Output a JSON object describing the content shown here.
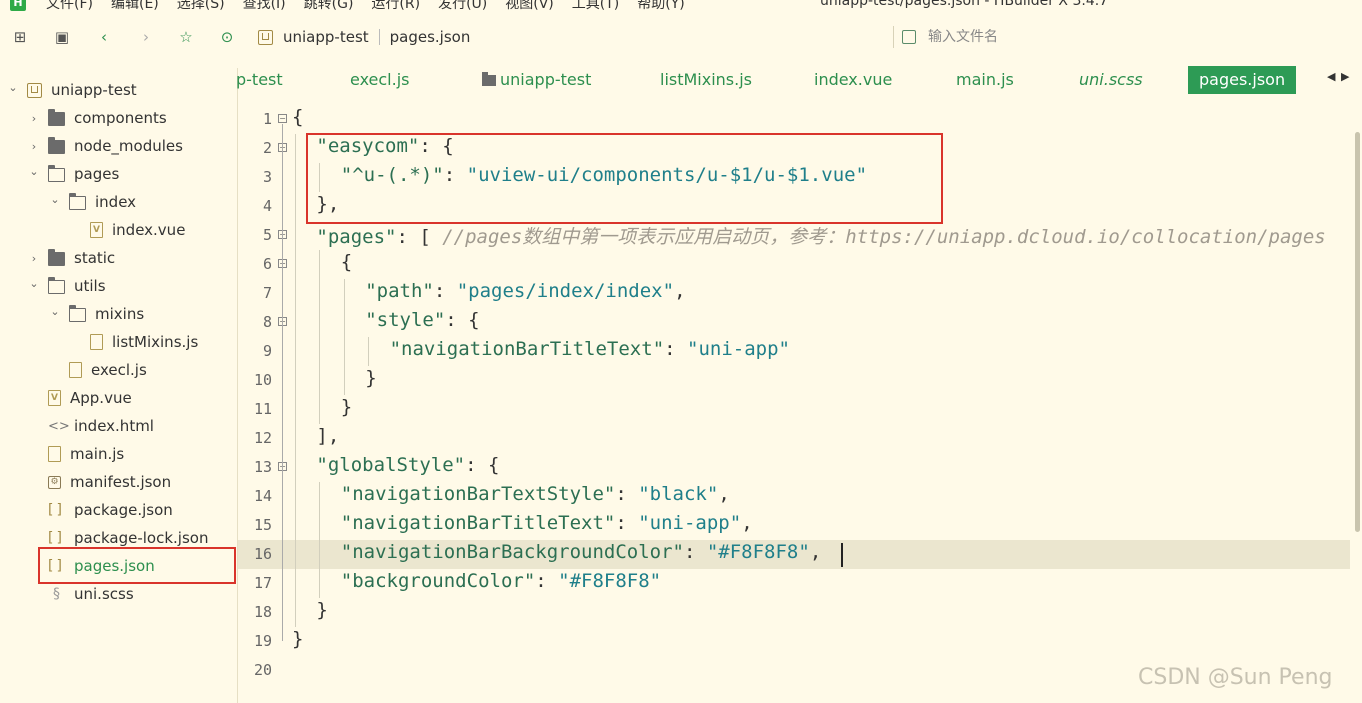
{
  "window": {
    "title": "uniapp-test/pages.json - HBuilder X 3.4.7",
    "menu": [
      "文件(F)",
      "编辑(E)",
      "选择(S)",
      "查找(I)",
      "跳转(G)",
      "运行(R)",
      "发行(U)",
      "视图(V)",
      "工具(T)",
      "帮助(Y)"
    ]
  },
  "toolbar": {
    "breadcrumb_project": "uniapp-test",
    "breadcrumb_file": "pages.json",
    "search_placeholder": "输入文件名"
  },
  "sidebar": {
    "items": [
      {
        "label": "uniapp-test",
        "type": "project",
        "depth": 0,
        "expanded": true
      },
      {
        "label": "components",
        "type": "folder",
        "depth": 1,
        "expanded": false
      },
      {
        "label": "node_modules",
        "type": "folder",
        "depth": 1,
        "expanded": false
      },
      {
        "label": "pages",
        "type": "folder",
        "depth": 1,
        "expanded": true
      },
      {
        "label": "index",
        "type": "folder",
        "depth": 2,
        "expanded": true
      },
      {
        "label": "index.vue",
        "type": "vue",
        "depth": 3
      },
      {
        "label": "static",
        "type": "folder",
        "depth": 1,
        "expanded": false
      },
      {
        "label": "utils",
        "type": "folder",
        "depth": 1,
        "expanded": true
      },
      {
        "label": "mixins",
        "type": "folder",
        "depth": 2,
        "expanded": true
      },
      {
        "label": "listMixins.js",
        "type": "js",
        "depth": 3
      },
      {
        "label": "execl.js",
        "type": "js",
        "depth": 2
      },
      {
        "label": "App.vue",
        "type": "vue",
        "depth": 1
      },
      {
        "label": "index.html",
        "type": "html",
        "depth": 1
      },
      {
        "label": "main.js",
        "type": "js",
        "depth": 1
      },
      {
        "label": "manifest.json",
        "type": "manifest",
        "depth": 1
      },
      {
        "label": "package.json",
        "type": "json",
        "depth": 1
      },
      {
        "label": "package-lock.json",
        "type": "json",
        "depth": 1
      },
      {
        "label": "pages.json",
        "type": "json",
        "depth": 1,
        "active": true
      },
      {
        "label": "uni.scss",
        "type": "scss",
        "depth": 1
      }
    ]
  },
  "tabs": [
    {
      "label": "p-test"
    },
    {
      "label": "execl.js"
    },
    {
      "label": "uniapp-test",
      "folder": true
    },
    {
      "label": "listMixins.js"
    },
    {
      "label": "index.vue"
    },
    {
      "label": "main.js"
    },
    {
      "label": "uni.scss",
      "italic": true
    },
    {
      "label": "pages.json",
      "active": true
    }
  ],
  "editor": {
    "lines": [
      {
        "num": "1",
        "fold": true,
        "indent": 0,
        "parts": [
          [
            "p",
            "{"
          ]
        ]
      },
      {
        "num": "2",
        "fold": true,
        "indent": 1,
        "parts": [
          [
            "k",
            "\"easycom\""
          ],
          [
            "p",
            ": {"
          ]
        ]
      },
      {
        "num": "3",
        "indent": 2,
        "parts": [
          [
            "k",
            "\"^u-(.*)\""
          ],
          [
            "p",
            ": "
          ],
          [
            "s",
            "\"uview-ui/components/u-$1/u-$1.vue\""
          ]
        ]
      },
      {
        "num": "4",
        "indent": 1,
        "parts": [
          [
            "p",
            "},"
          ]
        ]
      },
      {
        "num": "5",
        "fold": true,
        "indent": 1,
        "parts": [
          [
            "k",
            "\"pages\""
          ],
          [
            "p",
            ": [ "
          ],
          [
            "c",
            "//pages数组中第一项表示应用启动页，参考：https://uniapp.dcloud.io/collocation/pages"
          ]
        ]
      },
      {
        "num": "6",
        "fold": true,
        "indent": 2,
        "parts": [
          [
            "p",
            "{"
          ]
        ]
      },
      {
        "num": "7",
        "indent": 3,
        "parts": [
          [
            "k",
            "\"path\""
          ],
          [
            "p",
            ": "
          ],
          [
            "s",
            "\"pages/index/index\""
          ],
          [
            "p",
            ","
          ]
        ]
      },
      {
        "num": "8",
        "fold": true,
        "indent": 3,
        "parts": [
          [
            "k",
            "\"style\""
          ],
          [
            "p",
            ": {"
          ]
        ]
      },
      {
        "num": "9",
        "indent": 4,
        "parts": [
          [
            "k",
            "\"navigationBarTitleText\""
          ],
          [
            "p",
            ": "
          ],
          [
            "s",
            "\"uni-app\""
          ]
        ]
      },
      {
        "num": "10",
        "indent": 3,
        "parts": [
          [
            "p",
            "}"
          ]
        ]
      },
      {
        "num": "11",
        "indent": 2,
        "parts": [
          [
            "p",
            "}"
          ]
        ]
      },
      {
        "num": "12",
        "indent": 1,
        "parts": [
          [
            "p",
            "],"
          ]
        ]
      },
      {
        "num": "13",
        "fold": true,
        "indent": 1,
        "parts": [
          [
            "k",
            "\"globalStyle\""
          ],
          [
            "p",
            ": {"
          ]
        ]
      },
      {
        "num": "14",
        "indent": 2,
        "parts": [
          [
            "k",
            "\"navigationBarTextStyle\""
          ],
          [
            "p",
            ": "
          ],
          [
            "s",
            "\"black\""
          ],
          [
            "p",
            ","
          ]
        ]
      },
      {
        "num": "15",
        "indent": 2,
        "parts": [
          [
            "k",
            "\"navigationBarTitleText\""
          ],
          [
            "p",
            ": "
          ],
          [
            "s",
            "\"uni-app\""
          ],
          [
            "p",
            ","
          ]
        ]
      },
      {
        "num": "16",
        "indent": 2,
        "current": true,
        "parts": [
          [
            "k",
            "\"navigationBarBackgroundColor\""
          ],
          [
            "p",
            ": "
          ],
          [
            "s",
            "\"#F8F8F8\""
          ],
          [
            "p",
            ","
          ]
        ]
      },
      {
        "num": "17",
        "indent": 2,
        "parts": [
          [
            "k",
            "\"backgroundColor\""
          ],
          [
            "p",
            ": "
          ],
          [
            "s",
            "\"#F8F8F8\""
          ]
        ]
      },
      {
        "num": "18",
        "indent": 1,
        "parts": [
          [
            "p",
            "}"
          ]
        ]
      },
      {
        "num": "19",
        "indent": 0,
        "parts": [
          [
            "p",
            "}"
          ]
        ]
      },
      {
        "num": "20",
        "indent": 0,
        "parts": []
      }
    ]
  },
  "watermark": "CSDN @Sun  Peng",
  "colors": {
    "accent": "#2d9b55",
    "highlight_box": "#d9342b",
    "background": "#fffae8",
    "key": "#2c6f52",
    "string": "#1f7f8a",
    "comment": "#a09a8f"
  }
}
